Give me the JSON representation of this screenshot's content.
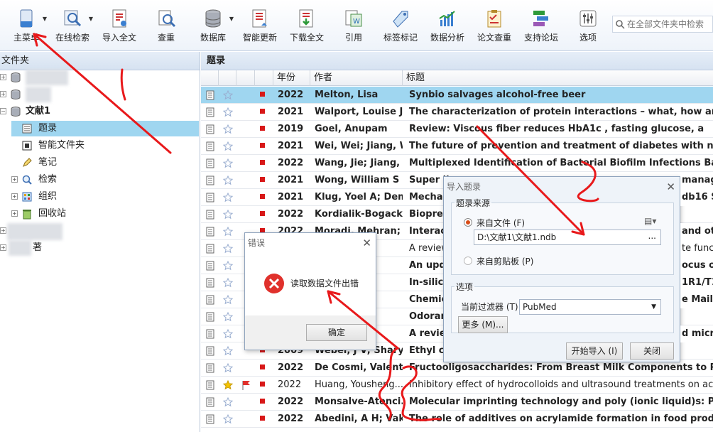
{
  "toolbar": {
    "items": [
      {
        "label": "主菜单",
        "dropdown": true
      },
      {
        "label": "在线检索",
        "dropdown": true
      },
      {
        "label": "导入全文"
      },
      {
        "label": "查重"
      },
      {
        "label": "数据库",
        "dropdown": true
      },
      {
        "label": "智能更新"
      },
      {
        "label": "下载全文"
      },
      {
        "label": "引用"
      },
      {
        "label": "标签标记"
      },
      {
        "label": "数据分析"
      },
      {
        "label": "论文查重"
      },
      {
        "label": "支持论坛"
      },
      {
        "label": "选项"
      }
    ],
    "search_placeholder": "在全部文件夹中检索"
  },
  "sidebar": {
    "header": "文件夹",
    "library": "文献1",
    "nodes": [
      "题录",
      "智能文件夹",
      "笔记",
      "检索",
      "组织",
      "回收站"
    ],
    "partial_label": "著"
  },
  "main": {
    "header": "题录",
    "columns": [
      "年份",
      "作者",
      "标题"
    ],
    "rows": [
      {
        "year": "2022",
        "author": "Melton, Lisa",
        "title": "Synbio salvages alcohol-free beer",
        "bold": true,
        "selected": true
      },
      {
        "year": "2021",
        "author": "Walport, Louise J;",
        "title": "The characterization of protein interactions – what, how and how",
        "bold": true
      },
      {
        "year": "2019",
        "author": "Goel, Anupam",
        "title": "Review: Viscous fiber reduces HbA1c            , fasting glucose, a",
        "bold": true
      },
      {
        "year": "2021",
        "author": "Wei, Wei; Jiang, W",
        "title": "The future of prevention and treatment of diabetes with nutrition",
        "bold": true
      },
      {
        "year": "2022",
        "author": "Wang, Jie; Jiang, Z",
        "title": "Multiplexed Identification of Bacterial Biofilm Infections Based o",
        "bold": true
      },
      {
        "year": "2021",
        "author": "Wong, William S .",
        "title": "Super li",
        "bold": true
      },
      {
        "year": "2021",
        "author": "Klug, Yoel A; Dem",
        "title": "Mechan",
        "bold": true
      },
      {
        "year": "2022",
        "author": "Kordialik-Bogacka",
        "title": "Biopres",
        "bold": true
      },
      {
        "year": "2022",
        "author": "Moradi, Mehran; .",
        "title": "Interact",
        "bold": true
      },
      {
        "year": "",
        "author": "Zh..",
        "title": "A review",
        "bold": false
      },
      {
        "year": "",
        "author": "a J;",
        "title": "An upd",
        "bold": true
      },
      {
        "year": "",
        "author": "Cui,",
        "title": "In-silico",
        "bold": true
      },
      {
        "year": "",
        "author": "esha",
        "title": "Chemic",
        "bold": true
      },
      {
        "year": "",
        "author": "Kno",
        "title": "Odoran",
        "bold": true
      },
      {
        "year": "",
        "author": "acha",
        "title": "A review",
        "bold": true
      },
      {
        "year": "2009",
        "author": "Weber, J V; Shary.",
        "title": "Ethyl ca",
        "bold": true
      },
      {
        "year": "2022",
        "author": "De Cosmi, Valenti.",
        "title": "Fructooligosaccharides: From Breast Milk Components to Potent",
        "bold": true
      },
      {
        "year": "2022",
        "author": "Huang, Yousheng...",
        "title": "Inhibitory effect of hydrocolloids and ultrasound treatments on acryla",
        "bold": false,
        "starred": true,
        "flag": true
      },
      {
        "year": "2022",
        "author": "Monsalve-Atenci..",
        "title": "Molecular imprinting technology and poly (ionic liquid)s: Promis",
        "bold": true
      },
      {
        "year": "2022",
        "author": "Abedini, A H; Vak",
        "title": "The role of additives on acrylamide formation in food products:",
        "bold": true
      }
    ],
    "right_fragments": [
      {
        "row": 5,
        "text": "manag"
      },
      {
        "row": 6,
        "text": "db16 S"
      },
      {
        "row": 8,
        "text": "and oth"
      },
      {
        "row": 9,
        "text": "te funct"
      },
      {
        "row": 10,
        "text": "ocus o"
      },
      {
        "row": 11,
        "text": "1R1/T1"
      },
      {
        "row": 12,
        "text": "e Maill"
      },
      {
        "row": 14,
        "text": "d micr"
      }
    ]
  },
  "error_dialog": {
    "title": "错误",
    "message": "读取数据文件出错",
    "ok": "确定"
  },
  "import_dialog": {
    "title": "导入题录",
    "source_group": "题录来源",
    "from_file": "来自文件 (F)",
    "file_path": "D:\\文献1\\文献1.ndb",
    "browse": "...",
    "from_clipboard": "来自剪贴板 (P)",
    "options_group": "选项",
    "filter_label": "当前过滤器 (T)",
    "filter_value": "PubMed",
    "more": "更多 (M)...",
    "start": "开始导入 (I)",
    "close": "关闭"
  },
  "colors": {
    "selected_row": "#9fd6f0",
    "header_bg": "#dce6f2",
    "error_red": "#e0312c",
    "annotation_red": "#e8191b"
  }
}
